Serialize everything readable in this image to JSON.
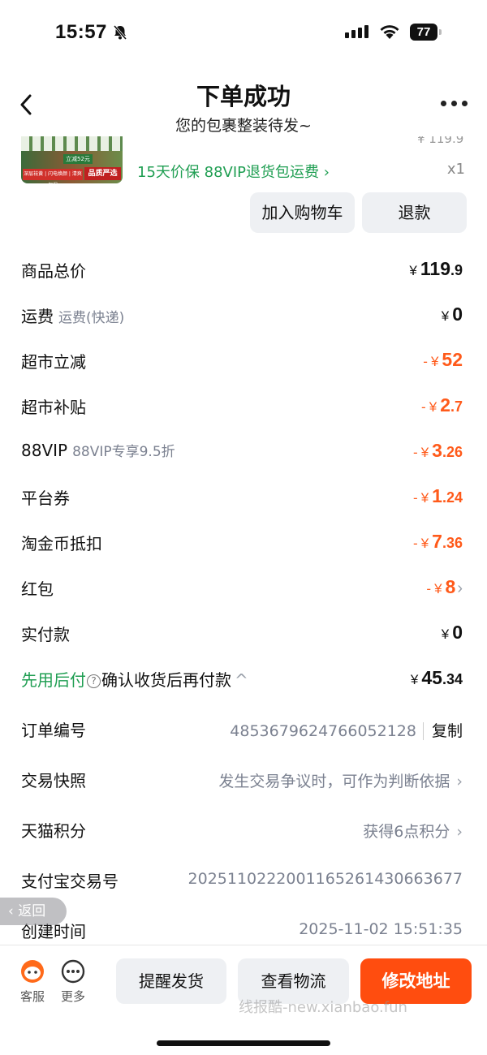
{
  "status_bar": {
    "time": "15:57",
    "battery": "77"
  },
  "header": {
    "title": "下单成功",
    "subtitle": "您的包裹整装待发~"
  },
  "product": {
    "price_partial": "¥ 119.9",
    "thumb_tag1": "立减52元",
    "thumb_tag2": "深层祛黄 | 闪电焕颜 | 清爽保湿",
    "thumb_tag3": "品质严选",
    "service_tags": "15天价保  88VIP退货包运费 ›",
    "quantity": "x1"
  },
  "actions": {
    "add_to_cart": "加入购物车",
    "refund": "退款"
  },
  "rows": {
    "goods_total": {
      "label": "商品总价",
      "currency": "¥",
      "int": "119",
      "dec": ".9"
    },
    "shipping": {
      "label": "运费",
      "sub": "运费(快递)",
      "currency": "¥",
      "int": "0"
    },
    "supermarket_discount": {
      "label": "超市立减",
      "prefix": "-",
      "currency": "¥",
      "int": "52"
    },
    "supermarket_subsidy": {
      "label": "超市补贴",
      "prefix": "-",
      "currency": "¥",
      "int": "2",
      "dec": ".7"
    },
    "vip": {
      "label": "88VIP",
      "sub": "88VIP专享9.5折",
      "prefix": "-",
      "currency": "¥",
      "int": "3",
      "dec": ".26"
    },
    "platform_coupon": {
      "label": "平台券",
      "prefix": "-",
      "currency": "¥",
      "int": "1",
      "dec": ".24"
    },
    "taojinbi": {
      "label": "淘金币抵扣",
      "prefix": "-",
      "currency": "¥",
      "int": "7",
      "dec": ".36"
    },
    "red_packet": {
      "label": "红包",
      "prefix": "-",
      "currency": "¥",
      "int": "8",
      "chev": "›"
    },
    "paid": {
      "label": "实付款",
      "currency": "¥",
      "int": "0"
    },
    "pay_later": {
      "label_green": "先用后付",
      "help": "?",
      "label_rest": "确认收货后再付款",
      "chev": "^",
      "currency": "¥",
      "int": "45",
      "dec": ".34"
    }
  },
  "info": {
    "order_no": {
      "label": "订单编号",
      "value": "4853679624766052128",
      "action": "复制"
    },
    "snapshot": {
      "label": "交易快照",
      "value": "发生交易争议时，可作为判断依据",
      "chev": "›"
    },
    "points": {
      "label": "天猫积分",
      "value": "获得6点积分",
      "chev": "›"
    },
    "alipay": {
      "label": "支付宝交易号",
      "value": "2025110222001165261430663677"
    },
    "created": {
      "label": "创建时间",
      "value": "2025-11-02 15:51:35"
    }
  },
  "back_pill": "‹ 返回",
  "bottom": {
    "service": "客服",
    "more": "更多",
    "remind": "提醒发货",
    "logistics": "查看物流",
    "change_address": "修改地址",
    "watermark": "线报酷-new.xianbao.fun"
  },
  "colors": {
    "accent": "#ff4d0f",
    "discount": "#ff5a1a",
    "green": "#1f9e52",
    "muted": "#7b8190"
  }
}
